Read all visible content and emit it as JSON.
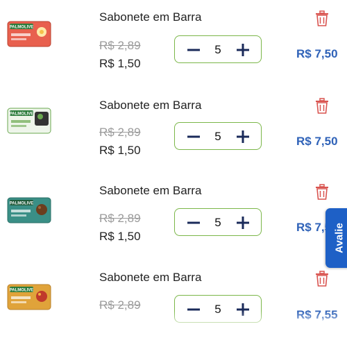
{
  "cart": {
    "brand_colors": {
      "accent": "#2f62b8",
      "qty_border": "#7ab648",
      "trash": "#d9534f",
      "avalie_bg": "#1e60c6"
    },
    "items": [
      {
        "name": "Sabonete em Barra",
        "image_icon": "palmolive-soap-oleo-nutritivo-image",
        "image_label": "PALMOLIVE",
        "image_sublabel": "Óleo Nutritivo",
        "image_color": "#e8604e",
        "old_price": "R$ 2,89",
        "price": "R$ 1,50",
        "quantity": "5",
        "total": "R$ 7,50",
        "minus_icon": "minus-icon",
        "plus_icon": "plus-icon",
        "trash_icon": "trash-icon"
      },
      {
        "name": "Sabonete em Barra",
        "image_icon": "palmolive-soap-sensacao-purificante-image",
        "image_label": "PALMOLIVE",
        "image_sublabel": "Sensação Purificante",
        "image_color": "#6aa84f",
        "old_price": "R$ 2,89",
        "price": "R$ 1,50",
        "quantity": "5",
        "total": "R$ 7,50",
        "minus_icon": "minus-icon",
        "plus_icon": "plus-icon",
        "trash_icon": "trash-icon"
      },
      {
        "name": "Sabonete em Barra",
        "image_icon": "palmolive-soap-esfoliacao-delicada-image",
        "image_label": "PALMOLIVE",
        "image_sublabel": "Esfoliação Delicada",
        "image_color": "#3a8f86",
        "old_price": "R$ 2,89",
        "price": "R$ 1,50",
        "quantity": "5",
        "total": "R$ 7,50",
        "minus_icon": "minus-icon",
        "plus_icon": "plus-icon",
        "trash_icon": "trash-icon"
      },
      {
        "name": "Sabonete em Barra",
        "image_icon": "palmolive-soap-sensacao-luminosa-image",
        "image_label": "PALMOLIVE",
        "image_sublabel": "Sensação Luminosa",
        "image_color": "#e0a33a",
        "old_price": "R$ 2,89",
        "price": "",
        "quantity": "5",
        "total": "R$ 7,55",
        "minus_icon": "minus-icon",
        "plus_icon": "plus-icon",
        "trash_icon": "trash-icon"
      }
    ]
  },
  "feedback_tab": {
    "label": "Avalie"
  }
}
